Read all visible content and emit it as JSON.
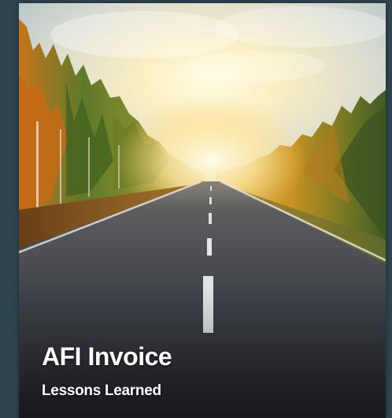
{
  "card": {
    "title": "AFI Invoice",
    "subtitle": "Lessons Learned",
    "image_subject": "road-through-autumn-forest-at-sunrise"
  },
  "colors": {
    "page_background": "#2e4550",
    "text": "#ffffff",
    "sky_glow": "#fff6c8",
    "asphalt": "#3a3d44",
    "road_marking": "#dfe4e6",
    "foliage_orange": "#d98a1c",
    "foliage_green": "#4f6b24"
  }
}
